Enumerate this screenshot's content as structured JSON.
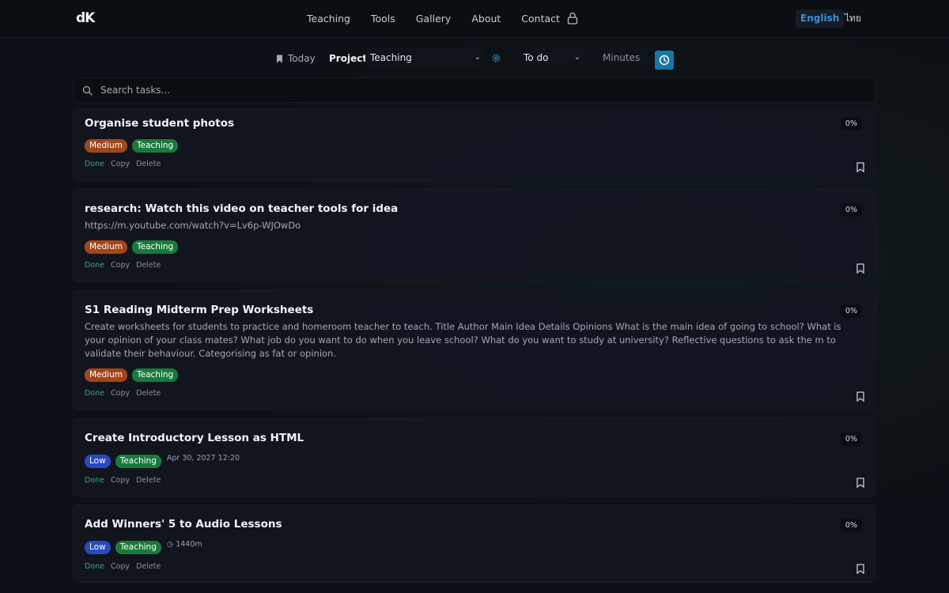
{
  "nav": {
    "logo": "dK",
    "links": [
      "Teaching",
      "Tools",
      "Gallery",
      "About",
      "Contact"
    ],
    "lang_en": "English",
    "lang_th": "ไทย"
  },
  "toolbar": {
    "today": "Today",
    "project_label": "Project:",
    "project_value": "Teaching",
    "status_value": "To do",
    "minutes_placeholder": "Minutes"
  },
  "search": {
    "placeholder": "Search tasks..."
  },
  "actions": {
    "done": "Done",
    "copy": "Copy",
    "delete": "Delete"
  },
  "tasks": [
    {
      "title": "Organise student photos",
      "desc": "",
      "priority": "Medium",
      "project": "Teaching",
      "meta": "",
      "progress": "0%"
    },
    {
      "title": "research: Watch this video on teacher tools for idea",
      "desc": "https://m.youtube.com/watch?v=Lv6p-WJOwDo",
      "priority": "Medium",
      "project": "Teaching",
      "meta": "",
      "progress": "0%"
    },
    {
      "title": "S1 Reading Midterm Prep Worksheets",
      "desc": "Create worksheets for students to practice and homeroom teacher to teach. Title Author Main Idea Details Opinions What is the main idea of going to school? What is your opinion of your class mates? What job do you want to do when you leave school? What do you want to study at university? Reflective questions to ask the m to validate their behaviour. Categorising as fat or opinion.",
      "priority": "Medium",
      "project": "Teaching",
      "meta": "",
      "progress": "0%"
    },
    {
      "title": "Create Introductory Lesson as HTML",
      "desc": "",
      "priority": "Low",
      "project": "Teaching",
      "meta": "Apr 30, 2027 12:20",
      "progress": "0%"
    },
    {
      "title": "Add Winners' 5 to Audio Lessons",
      "desc": "",
      "priority": "Low",
      "project": "Teaching",
      "meta": "1440m",
      "progress": "0%"
    }
  ],
  "colors": {
    "accent": "#1677a8",
    "medium": "#a0461c",
    "low": "#2749c1",
    "project": "#1b7a3b",
    "done": "#3aa867"
  }
}
